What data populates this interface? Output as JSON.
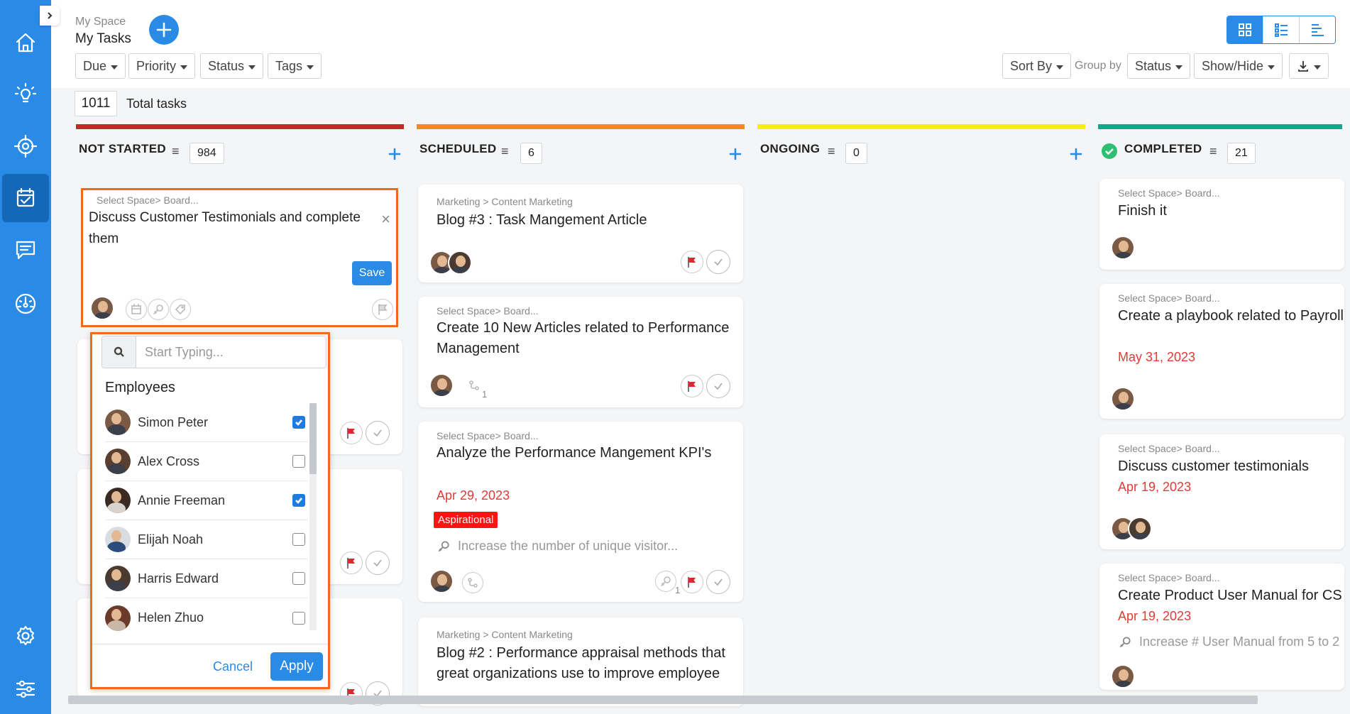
{
  "header": {
    "breadcrumb_parent": "My Space",
    "title": "My Tasks",
    "filters": [
      "Due",
      "Priority",
      "Status",
      "Tags"
    ],
    "sort_by": "Sort By",
    "group_by_label": "Group by",
    "group_by_value": "Status",
    "show_hide": "Show/Hide"
  },
  "summary": {
    "total_count": "1011",
    "total_label": "Total tasks"
  },
  "colors": {
    "accent": "#2a8be6",
    "not_started": "#c62828",
    "scheduled": "#ef8a2c",
    "ongoing": "#f5ef0c",
    "completed": "#1aa58a",
    "highlight": "#f06a1e"
  },
  "columns": [
    {
      "name": "NOT STARTED",
      "count": "984"
    },
    {
      "name": "SCHEDULED",
      "count": "6"
    },
    {
      "name": "ONGOING",
      "count": "0"
    },
    {
      "name": "COMPLETED",
      "count": "21"
    }
  ],
  "edit_card": {
    "crumb": "Select Space> Board...",
    "text_line1": "Discuss Customer Testimonials and complete",
    "text_line2": "them",
    "close": "×",
    "save": "Save"
  },
  "employee_picker": {
    "search_placeholder": "Start Typing...",
    "section": "Employees",
    "employees": [
      {
        "name": "Simon Peter",
        "checked": true
      },
      {
        "name": "Alex Cross",
        "checked": false
      },
      {
        "name": "Annie Freeman",
        "checked": true
      },
      {
        "name": "Elijah Noah",
        "checked": false
      },
      {
        "name": "Harris Edward",
        "checked": false
      },
      {
        "name": "Helen Zhuo",
        "checked": false
      }
    ],
    "cancel": "Cancel",
    "apply": "Apply"
  },
  "scheduled_cards": [
    {
      "crumb": "Marketing > Content Marketing",
      "title_line1": "Blog #3 : Task Mangement Article"
    },
    {
      "crumb": "Select Space> Board...",
      "title_line1": "Create 10 New Articles related to Performance",
      "title_line2": "Management",
      "subtask_count": "1"
    },
    {
      "crumb": "Select Space> Board...",
      "title_line1": "Analyze the Performance Mangement KPI's",
      "date": "Apr 29, 2023",
      "tag": "Aspirational",
      "key_result": "Increase the number of unique visitor...",
      "kr_count": "1"
    },
    {
      "crumb": "Marketing > Content Marketing",
      "title_line1": "Blog #2 : Performance appraisal methods that",
      "title_line2": "great organizations use to improve employee"
    }
  ],
  "completed_cards": [
    {
      "crumb": "Select Space> Board...",
      "title": "Finish it"
    },
    {
      "crumb": "Select Space> Board...",
      "title": "Create a playbook related to Payroll S",
      "date": "May 31, 2023"
    },
    {
      "crumb": "Select Space> Board...",
      "title": "Discuss customer testimonials",
      "date": "Apr 19, 2023"
    },
    {
      "crumb": "Select Space> Board...",
      "title": "Create Product User Manual for CS",
      "date": "Apr 19, 2023",
      "key_result": "Increase # User Manual from 5 to 2"
    }
  ]
}
